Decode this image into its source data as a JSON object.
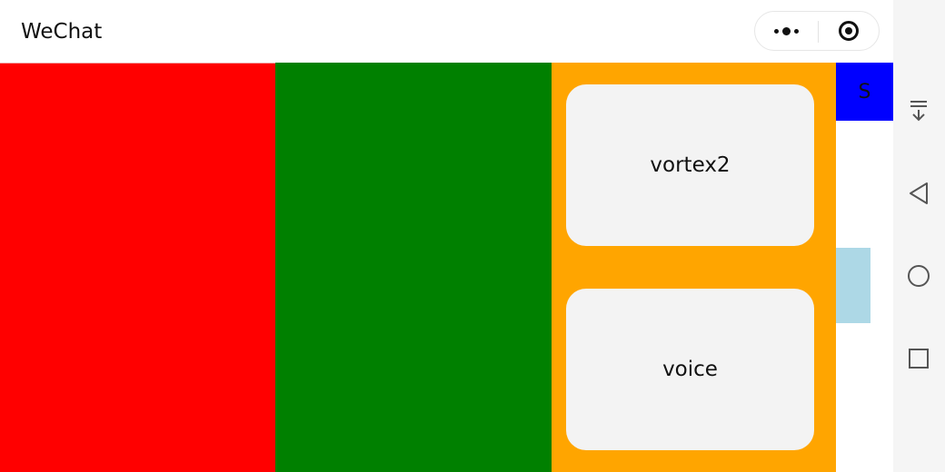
{
  "header": {
    "title": "WeChat",
    "more_icon": "more-dots-icon",
    "close_icon": "target-close-icon"
  },
  "columns": [
    {
      "name": "red-panel",
      "color": "#ff0000"
    },
    {
      "name": "green-panel",
      "color": "#008000"
    },
    {
      "name": "orange-panel",
      "color": "#ffa500"
    }
  ],
  "cards": [
    {
      "label": "vortex2"
    },
    {
      "label": "voice"
    }
  ],
  "side": {
    "s_label": "S",
    "s_color": "#0000ff",
    "light_color": "#add8e6"
  },
  "navbar": {
    "items": [
      {
        "icon": "collapse-down-icon"
      },
      {
        "icon": "back-triangle-icon"
      },
      {
        "icon": "home-circle-icon"
      },
      {
        "icon": "recents-square-icon"
      }
    ]
  }
}
